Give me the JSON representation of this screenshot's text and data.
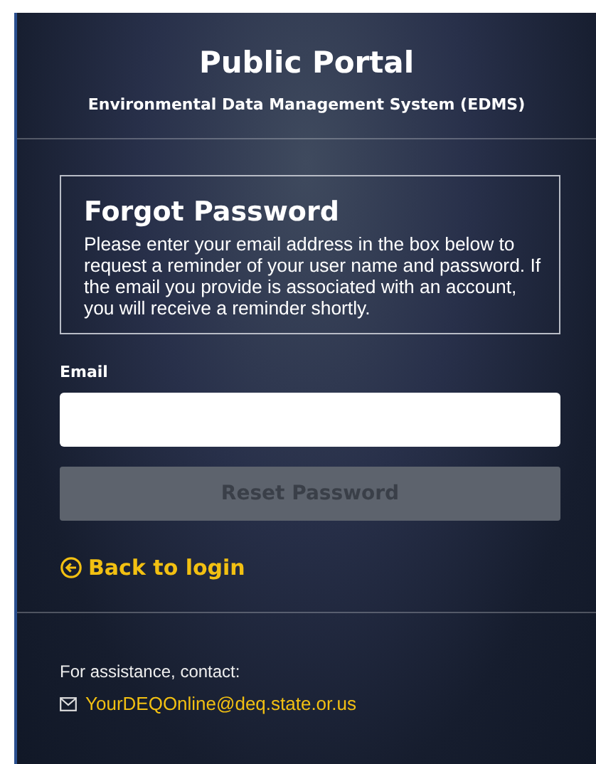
{
  "header": {
    "title": "Public Portal",
    "subtitle": "Environmental Data Management System (EDMS)"
  },
  "notice": {
    "title": "Forgot Password",
    "text": "Please enter your email address in the box below to request a reminder of your user name and password. If the email you provide is associated with an account, you will receive a reminder shortly."
  },
  "form": {
    "email_label": "Email",
    "reset_button": {
      "label": "Reset Password",
      "disabled": true
    },
    "back_link": "Back to login"
  },
  "footer": {
    "assistance": "For assistance, contact:",
    "email": "YourDEQOnline@deq.state.or.us"
  }
}
